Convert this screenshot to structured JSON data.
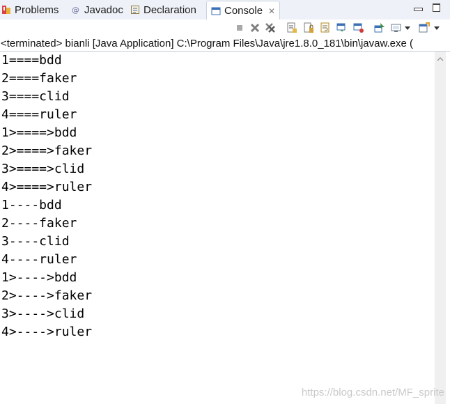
{
  "tabs": [
    {
      "label": "Problems",
      "icon": "problems-icon"
    },
    {
      "label": "Javadoc",
      "icon": "javadoc-icon"
    },
    {
      "label": "Declaration",
      "icon": "declaration-icon"
    },
    {
      "label": "Console",
      "icon": "console-icon",
      "active": true,
      "close": "✕"
    }
  ],
  "toolbar": {
    "icons": [
      "terminate-icon",
      "remove-launch-icon",
      "remove-all-launches-icon",
      "clear-console-icon",
      "scroll-lock-icon",
      "word-wrap-icon",
      "show-on-output-icon",
      "show-on-error-icon",
      "pin-console-icon",
      "display-console-icon",
      "display-dropdown-icon",
      "open-console-icon",
      "open-console-dropdown-icon"
    ]
  },
  "status": {
    "text": "<terminated> bianli [Java Application] C:\\Program Files\\Java\\jre1.8.0_181\\bin\\javaw.exe ("
  },
  "console": {
    "lines": [
      "1====bdd",
      "2====faker",
      "3====clid",
      "4====ruler",
      "1>====>bdd",
      "2>====>faker",
      "3>====>clid",
      "4>====>ruler",
      "1----bdd",
      "2----faker",
      "3----clid",
      "4----ruler",
      "1>---->bdd",
      "2>---->faker",
      "3>---->clid",
      "4>---->ruler"
    ]
  },
  "watermark": "https://blog.csdn.net/MF_sprite",
  "colors": {
    "tabbar_bg": "#eef2f8",
    "console_text": "#000000",
    "scrollbar": "#f0f0f0"
  }
}
